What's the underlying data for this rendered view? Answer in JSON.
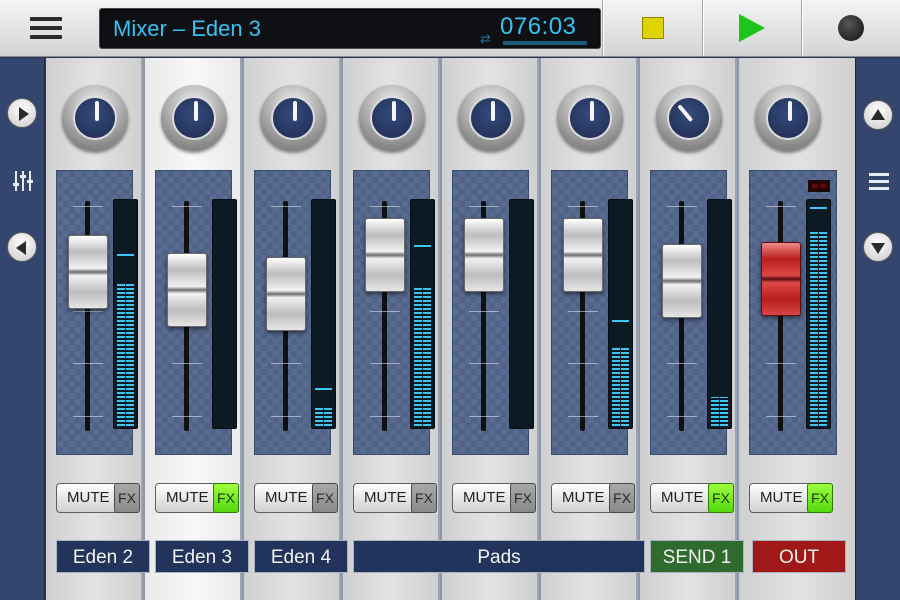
{
  "header": {
    "title": "Mixer – Eden 3",
    "time": "076:03"
  },
  "transport": {
    "stop_color": "#e0d400",
    "play_color": "#1dc51a",
    "record_color": "#1a1a1a"
  },
  "colors": {
    "accent": "#35c3f2",
    "meter": "#3dc6f4",
    "fx_on": "#6cf01f",
    "label_bg": "#23345c",
    "send_bg": "#2f6b2f",
    "out_bg": "#a11818"
  },
  "channels": [
    {
      "name": "Eden 2",
      "mute_label": "MUTE",
      "fx_label": "FX",
      "fx_on": false,
      "fader_level": 0.72,
      "meter_level": 0.63,
      "peak_level": 0.76,
      "knob": "centered"
    },
    {
      "name": "Eden 3",
      "mute_label": "MUTE",
      "fx_label": "FX",
      "fx_on": true,
      "fader_level": 0.6,
      "meter_level": 0.0,
      "peak_level": 0.0,
      "knob": "centered"
    },
    {
      "name": "Eden 4",
      "mute_label": "MUTE",
      "fx_label": "FX",
      "fx_on": false,
      "fader_level": 0.58,
      "meter_level": 0.08,
      "peak_level": 0.17,
      "knob": "centered"
    },
    {
      "name": "Pads",
      "mute_label": "MUTE",
      "fx_label": "FX",
      "fx_on": false,
      "fader_level": 0.83,
      "meter_level": 0.61,
      "peak_level": 0.8,
      "knob": "centered"
    },
    {
      "name": "",
      "mute_label": "MUTE",
      "fx_label": "FX",
      "fx_on": false,
      "fader_level": 0.83,
      "meter_level": 0.0,
      "peak_level": 0.0,
      "knob": "centered"
    },
    {
      "name": "",
      "mute_label": "MUTE",
      "fx_label": "FX",
      "fx_on": false,
      "fader_level": 0.83,
      "meter_level": 0.35,
      "peak_level": 0.47,
      "knob": "centered"
    },
    {
      "name": "SEND 1",
      "mute_label": "MUTE",
      "fx_label": "FX",
      "fx_on": true,
      "fader_level": 0.66,
      "meter_level": 0.13,
      "peak_level": 0.0,
      "knob": "turned"
    },
    {
      "name": "OUT",
      "mute_label": "MUTE",
      "fx_label": "FX",
      "fx_on": true,
      "fader_level": 0.67,
      "meter_level": 0.86,
      "peak_level": 0.97,
      "knob": "centered"
    }
  ],
  "labels": {
    "eden2": "Eden 2",
    "eden3": "Eden 3",
    "eden4": "Eden 4",
    "pads": "Pads",
    "send1": "SEND 1",
    "out": "OUT"
  },
  "icons": {
    "menu": "hamburger-menu-icon",
    "stop": "stop-icon",
    "play": "play-icon",
    "record": "record-icon",
    "loop": "loop-icon",
    "next": "chevron-right-icon",
    "prev": "chevron-left-icon",
    "mixer": "mixer-sliders-icon",
    "list": "list-icon",
    "up": "arrow-up-icon",
    "down": "arrow-down-icon"
  }
}
